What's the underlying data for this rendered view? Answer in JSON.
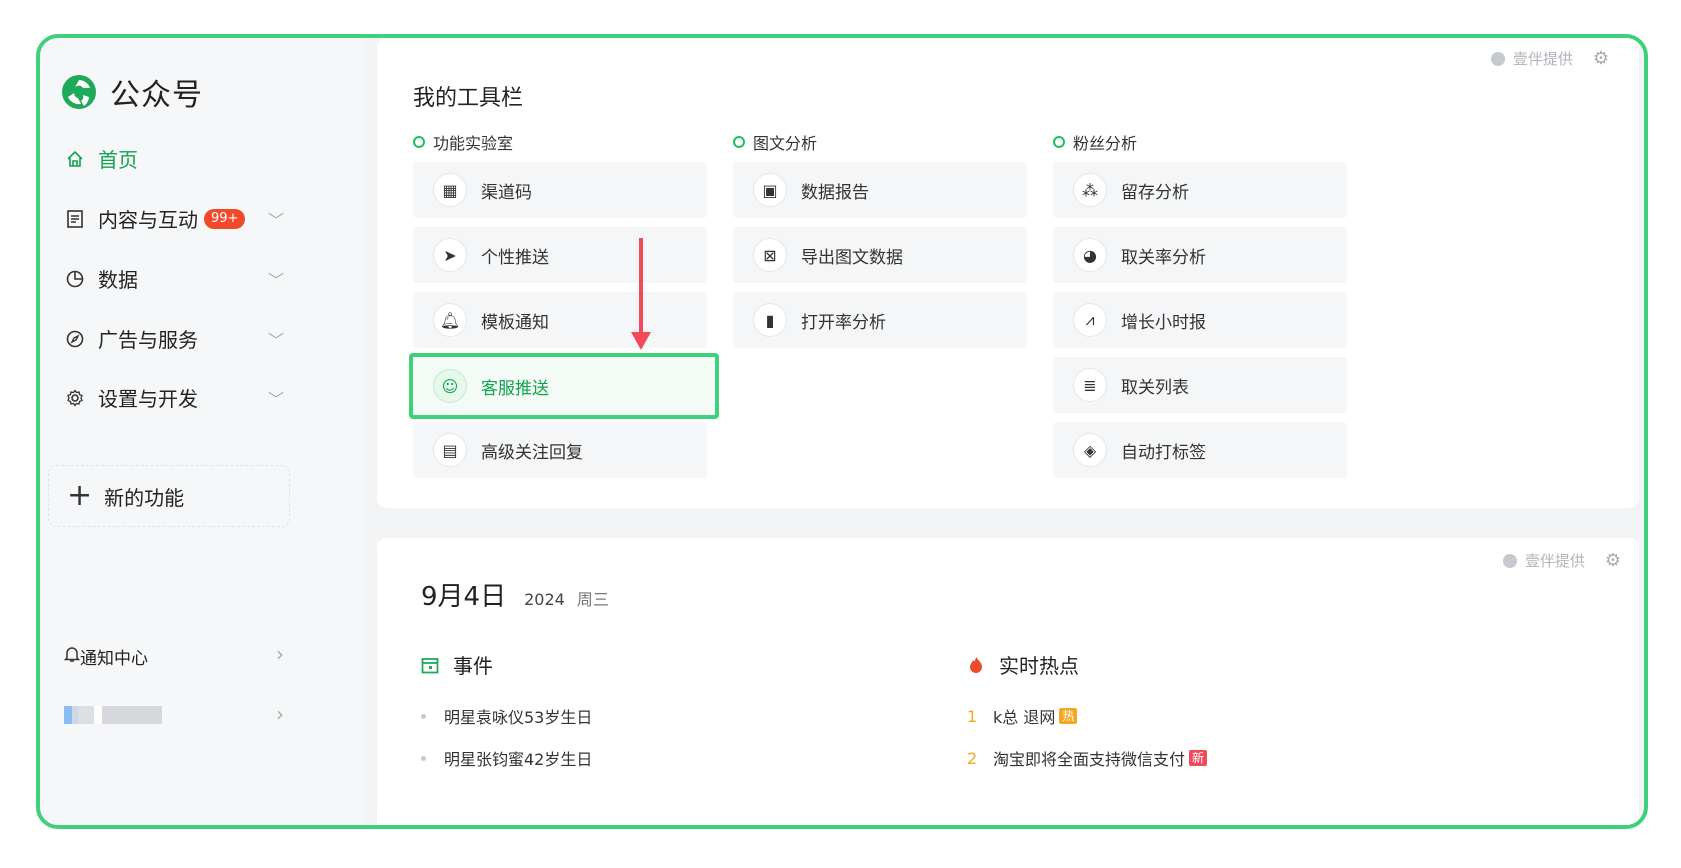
{
  "app": {
    "name": "公众号"
  },
  "sidebar": {
    "items": [
      {
        "label": "首页",
        "active": true
      },
      {
        "label": "内容与互动",
        "badge": "99+"
      },
      {
        "label": "数据"
      },
      {
        "label": "广告与服务"
      },
      {
        "label": "设置与开发"
      }
    ],
    "new_feature": "新的功能",
    "notification": "通知中心"
  },
  "toolbar_panel": {
    "provider": "壹伴提供",
    "title": "我的工具栏",
    "columns": [
      {
        "label": "功能实验室",
        "tools": [
          "渠道码",
          "个性推送",
          "模板通知",
          "客服推送",
          "高级关注回复"
        ]
      },
      {
        "label": "图文分析",
        "tools": [
          "数据报告",
          "导出图文数据",
          "打开率分析"
        ]
      },
      {
        "label": "粉丝分析",
        "tools": [
          "留存分析",
          "取关率分析",
          "增长小时报",
          "取关列表",
          "自动打标签"
        ]
      }
    ],
    "highlighted_tool": "客服推送"
  },
  "date_panel": {
    "provider": "壹伴提供",
    "date": "9月4日",
    "year": "2024",
    "weekday": "周三",
    "events_title": "事件",
    "events": [
      "明星袁咏仪53岁生日",
      "明星张钧蜜42岁生日"
    ],
    "hot_title": "实时热点",
    "hot": [
      {
        "rank": "1",
        "text": "k总 退网",
        "tag": "热"
      },
      {
        "rank": "2",
        "text": "淘宝即将全面支持微信支付",
        "tag": "新"
      }
    ]
  },
  "colors": {
    "accent": "#12a34e",
    "highlight_border": "#3ed07a",
    "badge": "#f04a2b",
    "arrow": "#f04a5b"
  }
}
